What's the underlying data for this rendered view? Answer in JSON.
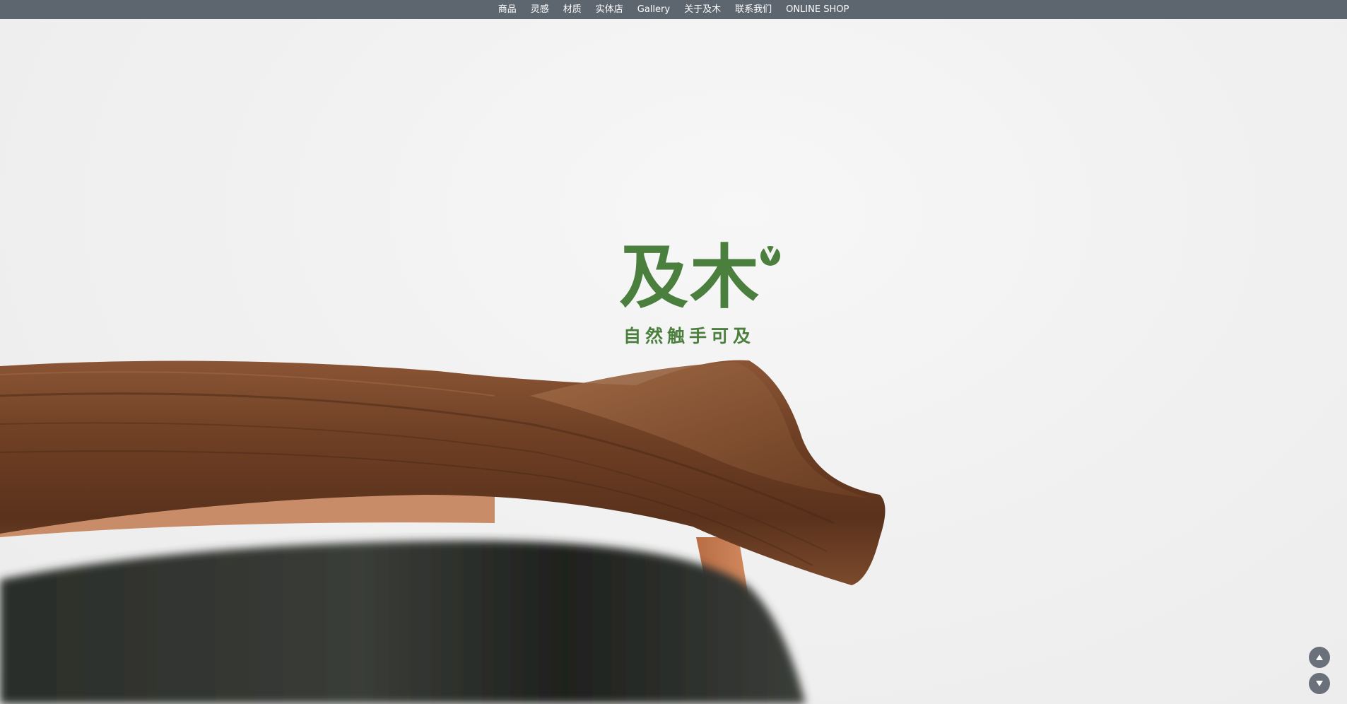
{
  "nav": {
    "items": [
      {
        "label": "商品"
      },
      {
        "label": "灵感"
      },
      {
        "label": "材质"
      },
      {
        "label": "实体店"
      },
      {
        "label": "Gallery"
      },
      {
        "label": "关于及木"
      },
      {
        "label": "联系我们"
      },
      {
        "label": "ONLINE SHOP"
      }
    ]
  },
  "logo": {
    "name": "及木",
    "tagline": "自然触手可及",
    "color": "#4b7f3e"
  },
  "scroll": {
    "up_icon": "triangle-up-icon",
    "down_icon": "triangle-down-icon"
  },
  "colors": {
    "nav_bg": "#5d656f",
    "wood": "#7a4a2b",
    "leather": "#2b2e2b"
  }
}
